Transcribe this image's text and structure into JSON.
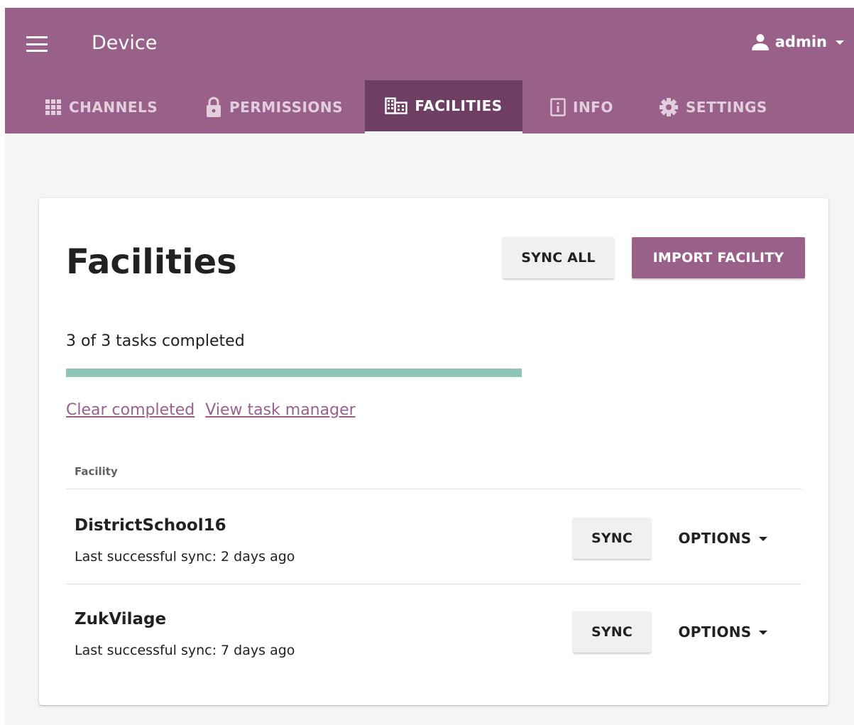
{
  "appbar": {
    "title": "Device",
    "user": {
      "name": "admin",
      "icon": "person-icon"
    }
  },
  "tabs": [
    {
      "label": "Channels",
      "icon": "apps-grid-icon",
      "active": false
    },
    {
      "label": "Permissions",
      "icon": "lock-icon",
      "active": false
    },
    {
      "label": "Facilities",
      "icon": "business-building-icon",
      "active": true
    },
    {
      "label": "Info",
      "icon": "info-icon",
      "active": false
    },
    {
      "label": "Settings",
      "icon": "settings-gear-icon",
      "active": false
    }
  ],
  "main": {
    "title": "Facilities",
    "sync_all_label": "Sync all",
    "import_label": "Import facility",
    "tasks_status": "3 of 3 tasks completed",
    "progress_fraction": 1.0,
    "clear_link": "Clear completed",
    "task_manager_link": "View task manager",
    "column_header": "Facility",
    "rows": [
      {
        "name": "DistrictSchool16",
        "last_sync": "Last successful sync: 2 days ago",
        "sync_label": "Sync",
        "options_label": "Options"
      },
      {
        "name": "ZukVilage",
        "last_sync": "Last successful sync: 7 days ago",
        "sync_label": "Sync",
        "options_label": "Options"
      }
    ]
  },
  "colors": {
    "appbar": "#996189",
    "active_tab": "#6e3f62",
    "primary_button": "#996189",
    "progress": "#8dc5b6",
    "background": "#f5f5f5"
  }
}
